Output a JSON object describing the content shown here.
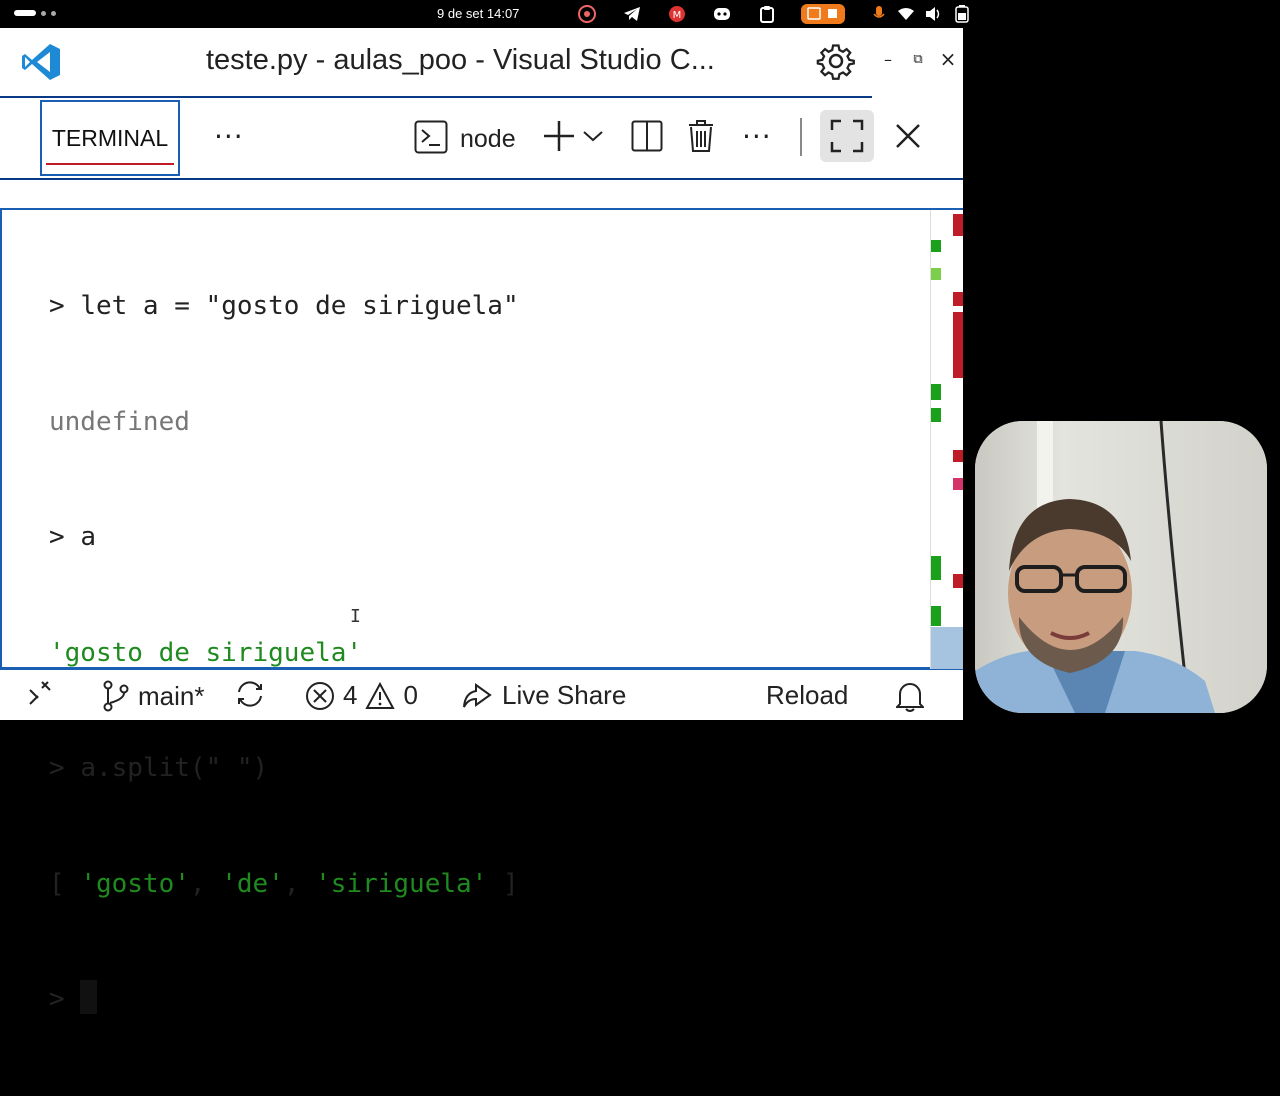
{
  "statusbar": {
    "clock": "9 de set  14:07"
  },
  "window": {
    "title": "teste.py - aulas_poo - Visual Studio C...",
    "controls": {
      "minimize": "–",
      "restore": "⧉",
      "close": "×"
    }
  },
  "panel": {
    "tab_label": "TERMINAL",
    "more_label": "···",
    "terminal_name": "node",
    "more2_label": "···"
  },
  "terminal": {
    "lines": [
      {
        "prompt": "> ",
        "text": "let a = \"gosto de siriguela\"",
        "style": "input"
      },
      {
        "prompt": "",
        "text": "undefined",
        "style": "gray"
      },
      {
        "prompt": "> ",
        "text": "a",
        "style": "input"
      },
      {
        "prompt": "",
        "text": "'gosto de siriguela'",
        "style": "green"
      },
      {
        "prompt": "> ",
        "text": "a.split(\" \")",
        "style": "input"
      }
    ],
    "array_line": {
      "open": "[ ",
      "items": [
        "'gosto'",
        "'de'",
        "'siriguela'"
      ],
      "sep": ", ",
      "close": " ]"
    },
    "current_prompt": "> "
  },
  "status": {
    "branch": "main*",
    "errors": "4",
    "warnings": "0",
    "live_share": "Live Share",
    "reload": "Reload"
  },
  "colors": {
    "accent": "#1a5fb4",
    "border_dark": "#0a3a86",
    "string_green": "#1f8a1f",
    "muted_gray": "#777777",
    "tab_underline": "#c01c28"
  }
}
